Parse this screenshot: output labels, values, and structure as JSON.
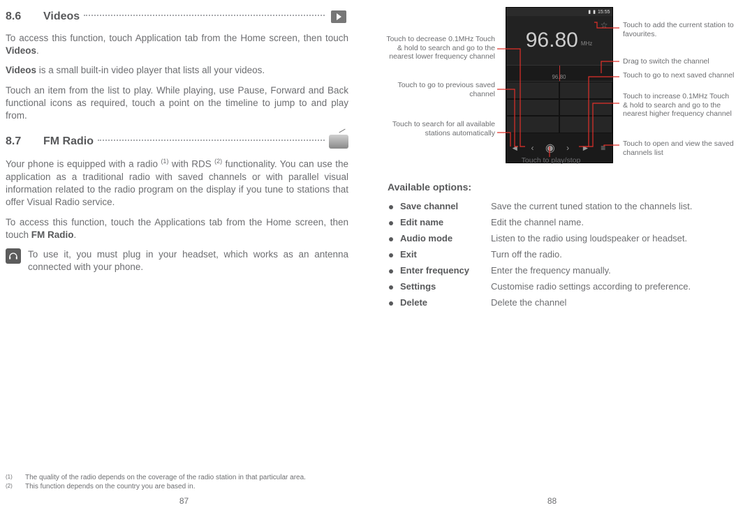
{
  "left": {
    "sec86": {
      "num": "8.6",
      "title": "Videos"
    },
    "p1a": "To access this function, touch Application tab from the Home screen, then touch ",
    "p1b": "Videos",
    "p1c": ".",
    "p2a": "Videos",
    "p2b": " is a small built-in video player that lists all your videos.",
    "p3": "Touch an item from the list to play. While playing, use Pause, Forward and Back functional icons as required, touch a point on the timeline to jump to and play from.",
    "sec87": {
      "num": "8.7",
      "title": "FM Radio"
    },
    "p4a": "Your phone is equipped with a radio ",
    "p4sup1": "(1)",
    "p4b": " with RDS ",
    "p4sup2": "(2)",
    "p4c": " functionality. You can use the application as a traditional radio with saved channels or with parallel visual information related to the radio program on the display if you tune to stations that offer Visual Radio service.",
    "p5a": "To access this function, touch the Applications tab from the Home screen, then touch ",
    "p5b": "FM Radio",
    "p5c": ".",
    "note": "To use it, you must plug in your headset, which works as an antenna connected with your phone.",
    "fn1": {
      "sup": "(1)",
      "text": "The quality of the radio depends on the coverage of the radio station in that particular area."
    },
    "fn2": {
      "sup": "(2)",
      "text": "This function depends on the country you are based in."
    },
    "pgnum": "87"
  },
  "right": {
    "phone": {
      "time": "15:55",
      "freq": "96.80",
      "unit": "MHz",
      "dial": "96.80"
    },
    "callouts": {
      "l1": "Touch to decrease 0.1MHz\nTouch & hold to search and go to the nearest lower frequency channel",
      "l2": "Touch to go to previous saved channel",
      "l3": "Touch to search for all available stations automatically",
      "bottom": "Touch to play/stop",
      "r1": "Touch to add the current station to favourites.",
      "r2": "Drag to switch the channel",
      "r3": "Touch to go to next saved channel",
      "r4": "Touch to increase 0.1MHz Touch & hold to search and go to the nearest higher frequency channel",
      "r5": "Touch to open and view the saved channels list"
    },
    "optsHead": "Available options:",
    "opts": [
      {
        "label": "Save channel",
        "desc": "Save the current tuned station to the channels list."
      },
      {
        "label": "Edit name",
        "desc": "Edit the channel name."
      },
      {
        "label": "Audio mode",
        "desc": "Listen to the radio using loudspeaker or headset."
      },
      {
        "label": "Exit",
        "desc": "Turn off the radio."
      },
      {
        "label": "Enter frequency",
        "desc": "Enter the frequency manually."
      },
      {
        "label": "Settings",
        "desc": "Customise radio settings according to preference."
      },
      {
        "label": "Delete",
        "desc": "Delete the channel"
      }
    ],
    "pgnum": "88"
  }
}
